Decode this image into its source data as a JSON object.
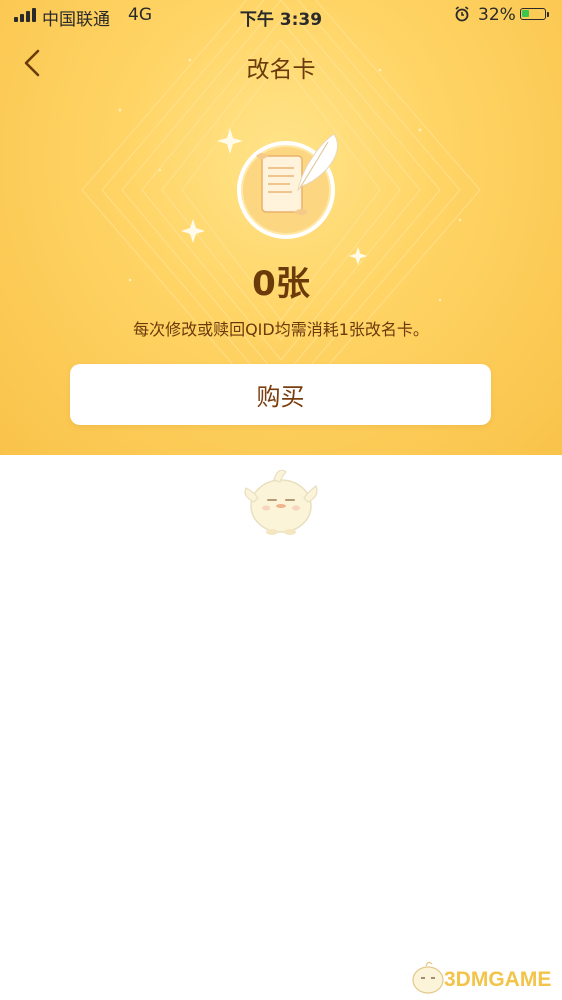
{
  "status_bar": {
    "carrier": "中国联通",
    "network": "4G",
    "time": "下午 3:39",
    "battery_percent": "32%",
    "battery_level": 0.32,
    "alarm_icon": "alarm-clock-icon"
  },
  "nav": {
    "back_icon": "chevron-left-icon",
    "title": "改名卡"
  },
  "card": {
    "emblem_icon": "scroll-quill-icon",
    "count": "0张",
    "description": "每次修改或赎回QID均需消耗1张改名卡。",
    "buy_label": "购买"
  },
  "empty_state": {
    "mascot_icon": "penguin-mascot-icon"
  },
  "watermark": {
    "text": "3DMGAME"
  },
  "colors": {
    "header_gradient_start": "#ffe48a",
    "header_gradient_end": "#f9c34a",
    "text_brown": "#6b3a0a",
    "battery_green": "#3cc64c",
    "watermark_gold": "#f3c44a"
  }
}
